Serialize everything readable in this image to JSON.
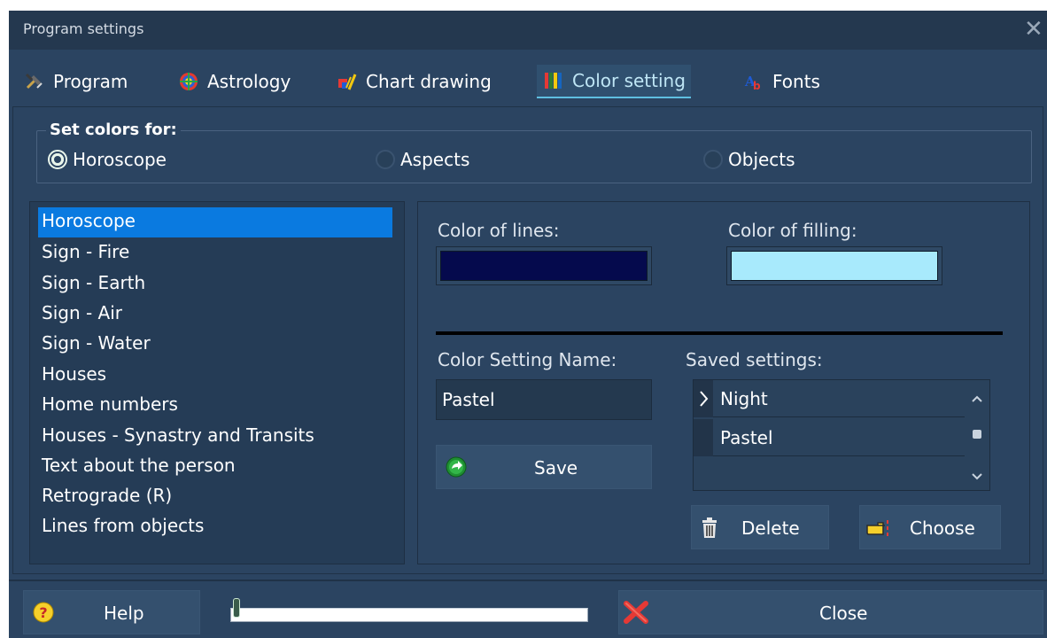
{
  "window": {
    "title": "Program settings"
  },
  "tabs": [
    {
      "label": "Program",
      "icon": "tools-icon"
    },
    {
      "label": "Astrology",
      "icon": "zodiac-wheel-icon"
    },
    {
      "label": "Chart drawing",
      "icon": "paint-icon"
    },
    {
      "label": "Color setting",
      "icon": "color-bars-icon",
      "active": true
    },
    {
      "label": "Fonts",
      "icon": "fonts-icon"
    }
  ],
  "set_colors": {
    "legend": "Set colors for:",
    "options": [
      {
        "label": "Horoscope",
        "checked": true
      },
      {
        "label": "Aspects",
        "checked": false
      },
      {
        "label": "Objects",
        "checked": false
      }
    ]
  },
  "items": [
    "Horoscope",
    "Sign - Fire",
    "Sign - Earth",
    "Sign - Air",
    "Sign - Water",
    "Houses",
    "Home numbers",
    "Houses - Synastry and Transits",
    "Text about the person",
    "Retrograde (R)",
    "Lines from objects"
  ],
  "selected_item": "Horoscope",
  "colors": {
    "lines_label": "Color of lines:",
    "lines_value": "#050a4d",
    "filling_label": "Color of filling:",
    "filling_value": "#a8eafc"
  },
  "setting_name": {
    "label": "Color Setting Name:",
    "value": "Pastel",
    "save_label": "Save"
  },
  "saved": {
    "label": "Saved settings:",
    "rows": [
      "Night",
      "Pastel"
    ],
    "current": "Night",
    "delete_label": "Delete",
    "choose_label": "Choose"
  },
  "footer": {
    "help_label": "Help",
    "close_label": "Close",
    "progress": 0
  },
  "theme": {
    "accent": "#0a7ae0",
    "background": "#2b4461"
  }
}
